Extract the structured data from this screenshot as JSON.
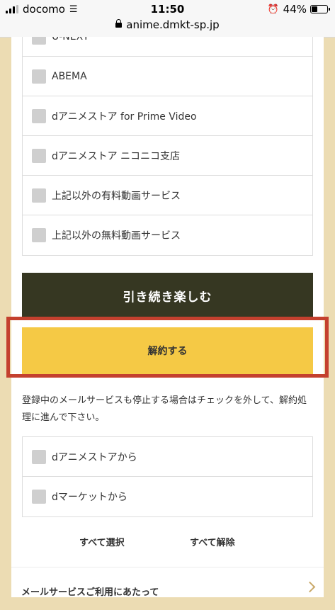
{
  "status_bar": {
    "carrier": "docomo",
    "time": "11:50",
    "url": "anime.dmkt-sp.jp",
    "battery": "44%",
    "battery_level": 0.44
  },
  "services": [
    {
      "label": "U-NEXT"
    },
    {
      "label": "ABEMA"
    },
    {
      "label": "dアニメストア for Prime Video"
    },
    {
      "label": "dアニメストア ニコニコ支店"
    },
    {
      "label": "上記以外の有料動画サービス"
    },
    {
      "label": "上記以外の無料動画サービス"
    }
  ],
  "buttons": {
    "continue_label": "引き続き楽しむ",
    "cancel_label": "解約する"
  },
  "note": "登録中のメールサービスも停止する場合はチェックを外して、解約処理に進んで下さい。",
  "mail_services": [
    {
      "label": "dアニメストアから"
    },
    {
      "label": "dマーケットから"
    }
  ],
  "select_all": "すべて選択",
  "deselect_all": "すべて解除",
  "footer": {
    "label": "メールサービスご利用にあたって"
  },
  "colors": {
    "continue_bg": "#363722",
    "cancel_bg": "#f5c945",
    "highlight_frame": "#c4402e",
    "page_bg": "#ecdcb3"
  }
}
